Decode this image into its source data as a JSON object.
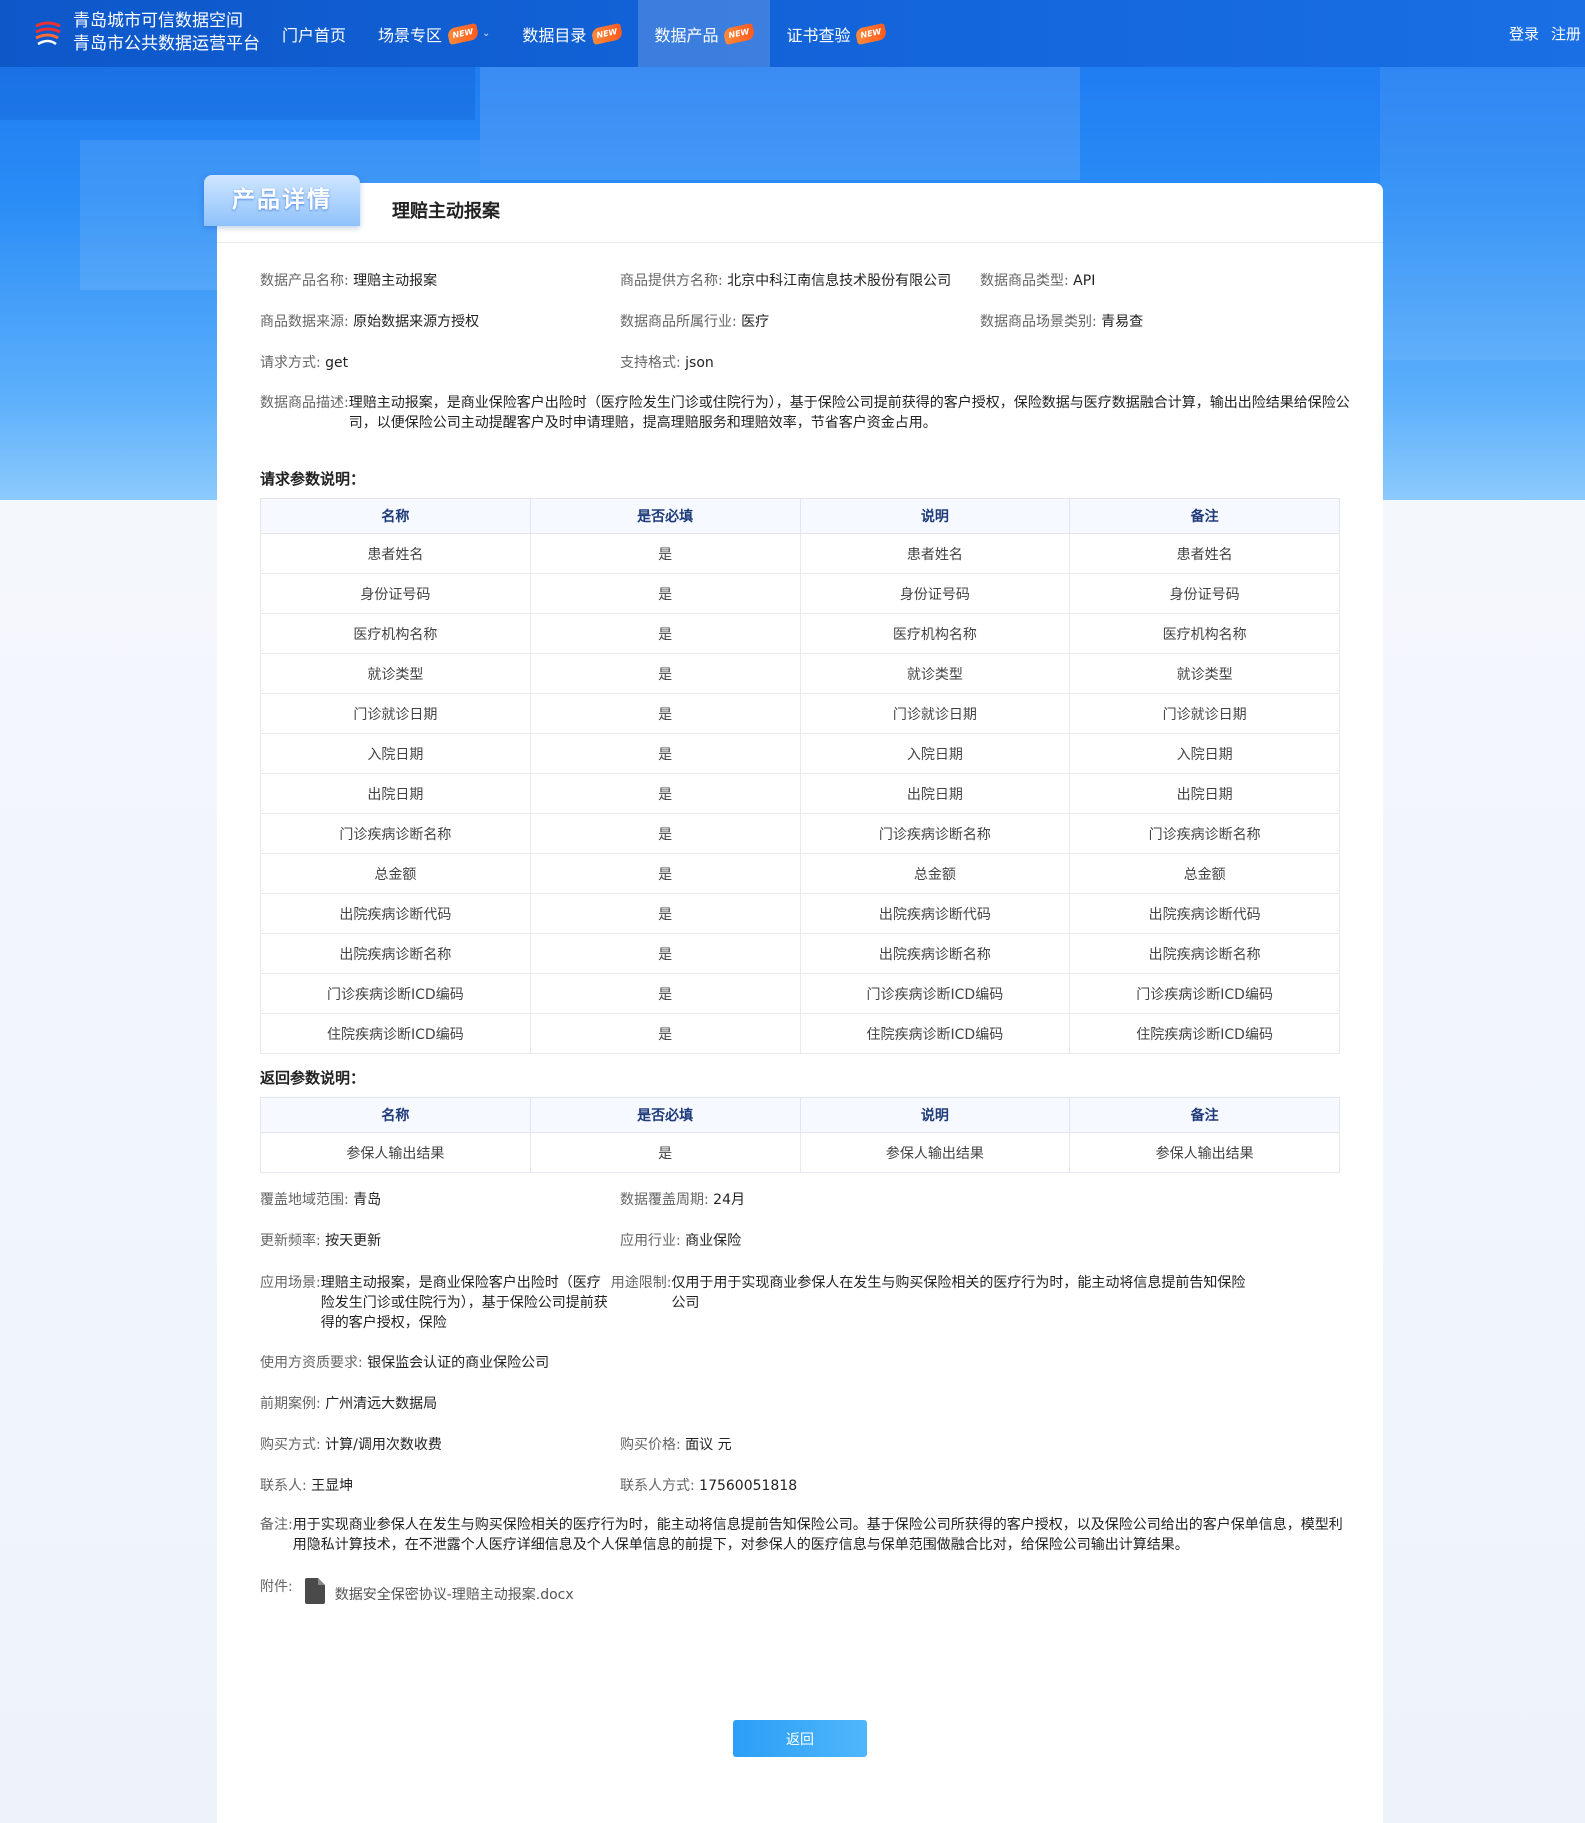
{
  "brand": {
    "line1": "青岛城市可信数据空间",
    "line2": "青岛市公共数据运营平台"
  },
  "nav": {
    "items": [
      {
        "label": "门户首页",
        "badge": ""
      },
      {
        "label": "场景专区",
        "badge": "NEW"
      },
      {
        "label": "数据目录",
        "badge": "NEW"
      },
      {
        "label": "数据产品",
        "badge": "NEW"
      },
      {
        "label": "证书查验",
        "badge": "NEW"
      }
    ],
    "login": "登录",
    "register": "注册"
  },
  "card": {
    "tab_label": "产品详情",
    "title": "理赔主动报案"
  },
  "info": {
    "product_name_label": "数据产品名称:",
    "product_name": "理赔主动报案",
    "provider_label": "商品提供方名称:",
    "provider": "北京中科江南信息技术股份有限公司",
    "type_label": "数据商品类型:",
    "type": "API",
    "source_label": "商品数据来源:",
    "source": "原始数据来源方授权",
    "industry_label": "数据商品所属行业:",
    "industry": "医疗",
    "scene_type_label": "数据商品场景类别:",
    "scene_type": "青易查",
    "method_label": "请求方式:",
    "method": "get",
    "format_label": "支持格式:",
    "format": "json",
    "desc_label": "数据商品描述:",
    "desc": "理赔主动报案，是商业保险客户出险时（医疗险发生门诊或住院行为），基于保险公司提前获得的客户授权，保险数据与医疗数据融合计算，输出出险结果给保险公司，以便保险公司主动提醒客户及时申请理赔，提高理赔服务和理赔效率，节省客户资金占用。"
  },
  "request": {
    "title": "请求参数说明：",
    "headers": [
      "名称",
      "是否必填",
      "说明",
      "备注"
    ],
    "rows": [
      [
        "患者姓名",
        "是",
        "患者姓名",
        "患者姓名"
      ],
      [
        "身份证号码",
        "是",
        "身份证号码",
        "身份证号码"
      ],
      [
        "医疗机构名称",
        "是",
        "医疗机构名称",
        "医疗机构名称"
      ],
      [
        "就诊类型",
        "是",
        "就诊类型",
        "就诊类型"
      ],
      [
        "门诊就诊日期",
        "是",
        "门诊就诊日期",
        "门诊就诊日期"
      ],
      [
        "入院日期",
        "是",
        "入院日期",
        "入院日期"
      ],
      [
        "出院日期",
        "是",
        "出院日期",
        "出院日期"
      ],
      [
        "门诊疾病诊断名称",
        "是",
        "门诊疾病诊断名称",
        "门诊疾病诊断名称"
      ],
      [
        "总金额",
        "是",
        "总金额",
        "总金额"
      ],
      [
        "出院疾病诊断代码",
        "是",
        "出院疾病诊断代码",
        "出院疾病诊断代码"
      ],
      [
        "出院疾病诊断名称",
        "是",
        "出院疾病诊断名称",
        "出院疾病诊断名称"
      ],
      [
        "门诊疾病诊断ICD编码",
        "是",
        "门诊疾病诊断ICD编码",
        "门诊疾病诊断ICD编码"
      ],
      [
        "住院疾病诊断ICD编码",
        "是",
        "住院疾病诊断ICD编码",
        "住院疾病诊断ICD编码"
      ]
    ]
  },
  "response": {
    "title": "返回参数说明：",
    "headers": [
      "名称",
      "是否必填",
      "说明",
      "备注"
    ],
    "rows": [
      [
        "参保人输出结果",
        "是",
        "参保人输出结果",
        "参保人输出结果"
      ]
    ]
  },
  "extra": {
    "region_label": "覆盖地域范围:",
    "region": "青岛",
    "period_label": "数据覆盖周期:",
    "period": "24月",
    "freq_label": "更新频率:",
    "freq": "按天更新",
    "app_industry_label": "应用行业:",
    "app_industry": "商业保险",
    "scene_label": "应用场景:",
    "scene": "理赔主动报案，是商业保险客户出险时（医疗险发生门诊或住院行为），基于保险公司提前获得的客户授权，保险",
    "limit_label": "用途限制:",
    "limit": "仅用于用于实现商业参保人在发生与购买保险相关的医疗行为时，能主动将信息提前告知保险公司",
    "qual_label": "使用方资质要求:",
    "qual": "银保监会认证的商业保险公司",
    "case_label": "前期案例:",
    "case": "广州清远大数据局",
    "buy_label": "购买方式:",
    "buy": "计算/调用次数收费",
    "price_label": "购买价格:",
    "price": "面议 元",
    "contact_label": "联系人:",
    "contact": "王显坤",
    "phone_label": "联系人方式:",
    "phone": "17560051818",
    "note_label": "备注:",
    "note": "用于实现商业参保人在发生与购买保险相关的医疗行为时，能主动将信息提前告知保险公司。基于保险公司所获得的客户授权，以及保险公司给出的客户保单信息，模型利用隐私计算技术，在不泄露个人医疗详细信息及个人保单信息的前提下，对参保人的医疗信息与保单范围做融合比对，给保险公司输出计算结果。",
    "attach_label": "附件:",
    "attach_file": "数据安全保密协议-理赔主动报案.docx"
  },
  "back_label": "返回",
  "colors": {
    "nav": "#1466dc",
    "accent": "#2b9ef7",
    "badge": "#ff5a1e"
  }
}
